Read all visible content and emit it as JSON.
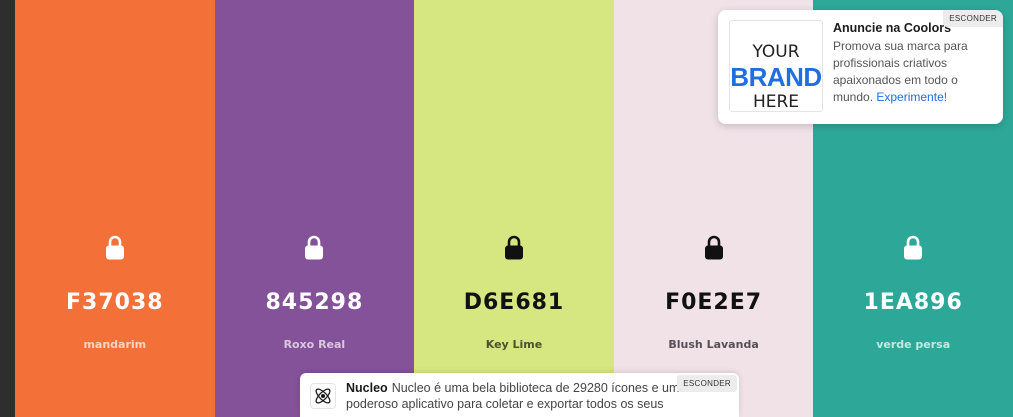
{
  "palette": {
    "swatches": [
      {
        "hex": "F37038",
        "name": "mandarim",
        "color": "#F37038",
        "text_color": "#ffffff",
        "name_color": "#fbd3c1",
        "lock_color": "#ffffff"
      },
      {
        "hex": "845298",
        "name": "Roxo Real",
        "color": "#845298",
        "text_color": "#ffffff",
        "name_color": "#d9c8e0",
        "lock_color": "#ffffff"
      },
      {
        "hex": "D6E681",
        "name": "Key Lime",
        "color": "#D6E681",
        "text_color": "#111111",
        "name_color": "#4a5230",
        "lock_color": "#111111"
      },
      {
        "hex": "F0E2E7",
        "name": "Blush Lavanda",
        "color": "#F0E2E7",
        "text_color": "#111111",
        "name_color": "#555055",
        "lock_color": "#111111"
      },
      {
        "hex": "1EA896",
        "name": "verde persa",
        "color": "#2DA898",
        "text_color": "#ffffff",
        "name_color": "#c2e8e2",
        "lock_color": "#ffffff"
      }
    ]
  },
  "ad": {
    "brand_line1": "YOUR",
    "brand_line2": "BRAND",
    "brand_line3": "HERE",
    "title": "Anuncie na Coolors",
    "body": "Promova sua marca para profissionais criativos apaixonados em todo o mundo.",
    "link": "Experimente!",
    "hide_label": "ESCONDER"
  },
  "bottom_ad": {
    "title": "Nucleo",
    "body": "Nucleo é uma bela biblioteca de 29280 ícones e um poderoso aplicativo para coletar e exportar todos os seus",
    "hide_label": "ESCONDER",
    "logo_icon": "atom-icon"
  }
}
